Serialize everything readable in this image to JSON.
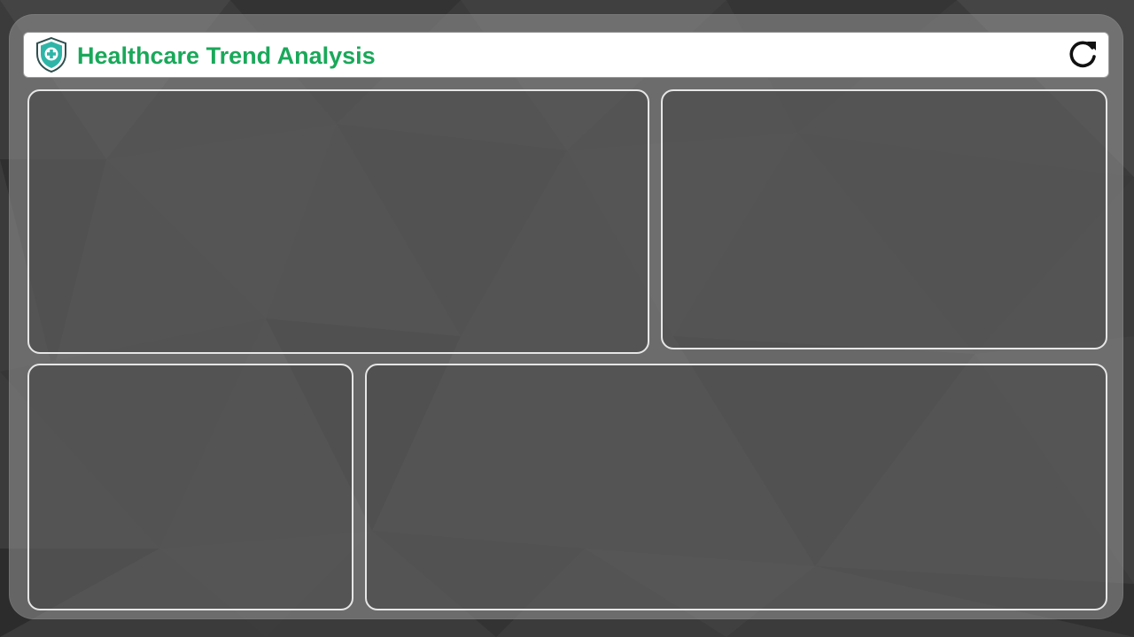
{
  "header": {
    "title": "Healthcare Trend Analysis",
    "logo_icon": "shield-medical-cross-icon",
    "refresh_icon": "refresh-icon"
  },
  "colors": {
    "title_green": "#1aa85a",
    "shield_teal": "#2fb5a8",
    "panel_border": "#e6e6e6",
    "background_dark": "#3a3a3a"
  },
  "panels": [
    "top-left-panel",
    "top-right-panel",
    "bottom-left-panel",
    "bottom-right-panel"
  ]
}
